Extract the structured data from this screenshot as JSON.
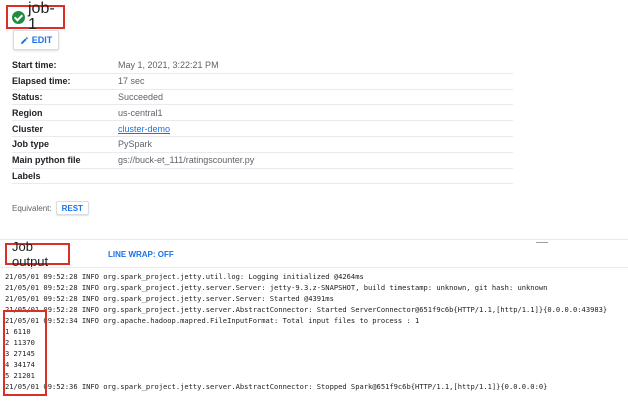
{
  "header": {
    "title": "job-1",
    "edit_label": "EDIT"
  },
  "details": [
    {
      "label": "Start time:",
      "value": "May 1, 2021, 3:22:21 PM"
    },
    {
      "label": "Elapsed time:",
      "value": "17 sec"
    },
    {
      "label": "Status:",
      "value": "Succeeded"
    },
    {
      "label": "Region",
      "value": "us-central1"
    },
    {
      "label": "Cluster",
      "value": "cluster-demo"
    },
    {
      "label": "Job type",
      "value": "PySpark"
    },
    {
      "label": "Main python file",
      "value": "gs://buck-et_111/ratingscounter.py"
    },
    {
      "label": "Labels",
      "value": ""
    }
  ],
  "equivalent": {
    "label": "Equivalent:",
    "rest_label": "REST"
  },
  "output": {
    "title": "Job output",
    "line_wrap_label": "LINE WRAP: OFF",
    "lines_top": [
      "21/05/01 09:52:28 INFO org.spark_project.jetty.util.log: Logging initialized @4264ms",
      "21/05/01 09:52:28 INFO org.spark_project.jetty.server.Server: jetty-9.3.z-SNAPSHOT, build timestamp: unknown, git hash: unknown",
      "21/05/01 09:52:28 INFO org.spark_project.jetty.server.Server: Started @4391ms",
      "21/05/01 09:52:28 INFO org.spark_project.jetty.server.AbstractConnector: Started ServerConnector@651f9c6b{HTTP/1.1,[http/1.1]}{0.0.0.0:43983}",
      "21/05/01 09:52:34 INFO org.apache.hadoop.mapred.FileInputFormat: Total input files to process : 1"
    ],
    "lines_results": [
      "1 6110",
      "2 11370",
      "3 27145",
      "4 34174",
      "5 21201"
    ],
    "line_last": "21/05/01 09:52:36 INFO org.spark_project.jetty.server.AbstractConnector: Stopped Spark@651f9c6b{HTTP/1.1,[http/1.1]}{0.0.0.0:0}"
  },
  "colors": {
    "accent": "#1a73e8",
    "success": "#1e8e3e",
    "highlight": "#d93025"
  }
}
